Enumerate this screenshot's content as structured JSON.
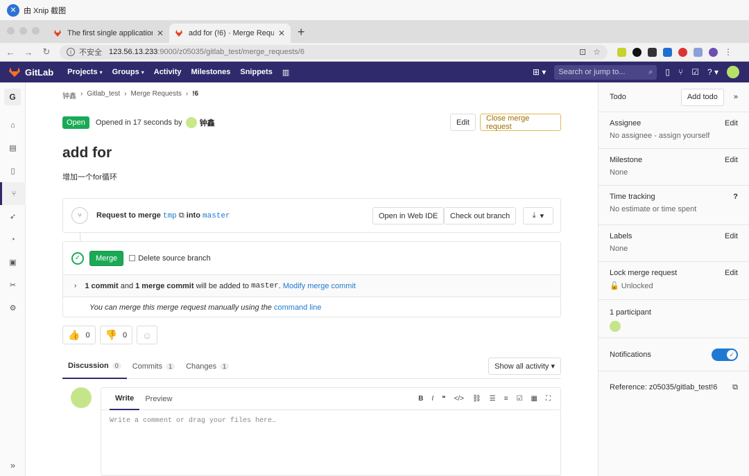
{
  "xnip": {
    "title": "由 Xnip 截图"
  },
  "browser": {
    "tabs": [
      {
        "title": "The first single application for"
      },
      {
        "title": "add for (!6) · Merge Requests"
      }
    ],
    "insecure_label": "不安全",
    "url_host": "123.56.13.233",
    "url_rest": ":9000/z05035/gitlab_test/merge_requests/6"
  },
  "header": {
    "brand": "GitLab",
    "nav": [
      "Projects",
      "Groups",
      "Activity",
      "Milestones",
      "Snippets"
    ],
    "search_placeholder": "Search or jump to..."
  },
  "sidebar": {
    "project_initial": "G"
  },
  "breadcrumb": [
    "钟鑫",
    "Gitlab_test",
    "Merge Requests",
    "!6"
  ],
  "mr": {
    "status": "Open",
    "opened_text": "Opened in 17 seconds by",
    "author": "钟鑫",
    "edit_label": "Edit",
    "close_label": "Close merge request",
    "title": "add for",
    "description": "增加一个for循环",
    "request_prefix": "Request to merge",
    "source_branch": "tmp",
    "into_label": "into",
    "target_branch": "master",
    "open_webide": "Open in Web IDE",
    "checkout": "Check out branch",
    "merge_label": "Merge",
    "delete_source": "Delete source branch",
    "commits_bold": "1 commit",
    "and_text": "and",
    "merge_commit_bold": "1 merge commit",
    "added_text": "will be added to",
    "added_target": "master",
    "modify_link": "Modify merge commit",
    "manual_text": "You can merge this merge request manually using the",
    "manual_link": "command line"
  },
  "awards": {
    "thumbs_up": "0",
    "thumbs_down": "0"
  },
  "tabs": [
    {
      "label": "Discussion",
      "count": "0"
    },
    {
      "label": "Commits",
      "count": "1"
    },
    {
      "label": "Changes",
      "count": "1"
    }
  ],
  "activity_filter": "Show all activity",
  "editor": {
    "write": "Write",
    "preview": "Preview",
    "placeholder": "Write a comment or drag your files here…"
  },
  "right": {
    "todo": "Todo",
    "add_todo": "Add todo",
    "assignee": "Assignee",
    "assignee_value": "No assignee - assign yourself",
    "milestone": "Milestone",
    "milestone_value": "None",
    "time_tracking": "Time tracking",
    "time_value": "No estimate or time spent",
    "labels": "Labels",
    "labels_value": "None",
    "lock": "Lock merge request",
    "lock_value": "Unlocked",
    "participants": "1 participant",
    "notifications": "Notifications",
    "reference": "Reference: z05035/gitlab_test!6",
    "edit": "Edit"
  },
  "colors": {
    "header": "#2f2a6b",
    "open_green": "#1aaa55",
    "link_blue": "#1f78d1",
    "close_orange": "#e0b94e"
  }
}
